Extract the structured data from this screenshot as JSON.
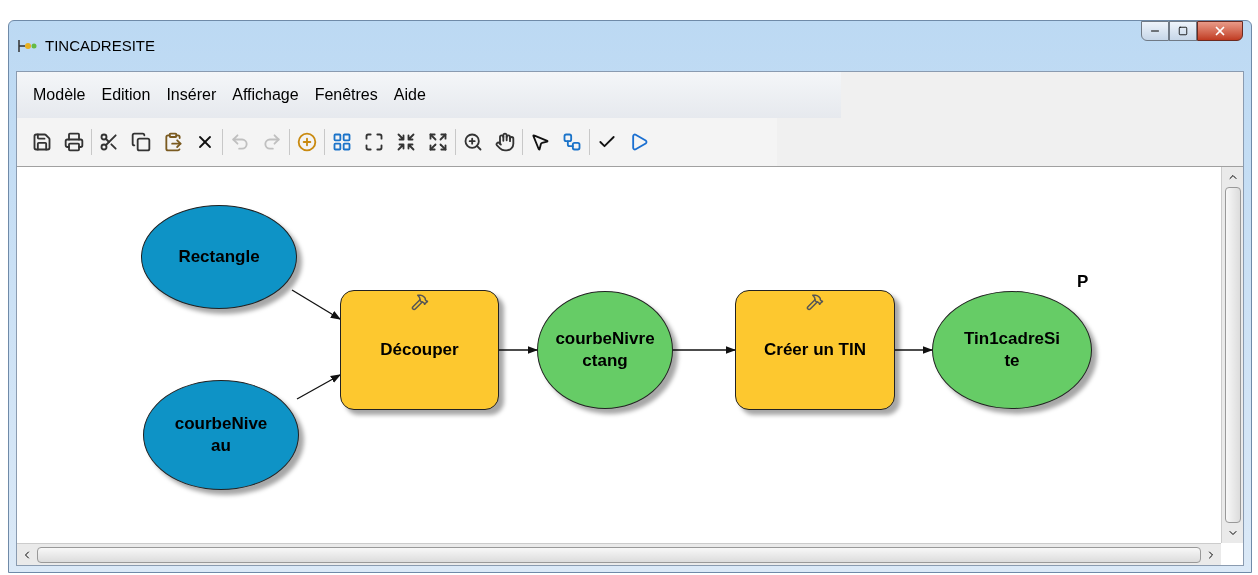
{
  "window": {
    "title": "TINCADRESITE"
  },
  "menu": [
    "Modèle",
    "Edition",
    "Insérer",
    "Affichage",
    "Fenêtres",
    "Aide"
  ],
  "toolbar": [
    [
      {
        "disabled": false
      },
      {
        "disabled": false
      }
    ],
    [
      {
        "disabled": false
      },
      {
        "disabled": false
      },
      {
        "disabled": false
      },
      {
        "disabled": false
      }
    ],
    [
      {
        "disabled": true
      },
      {
        "disabled": true
      }
    ],
    [
      {
        "disabled": false
      }
    ],
    [
      {
        "disabled": false
      },
      {
        "disabled": false
      },
      {
        "disabled": false
      },
      {
        "disabled": false
      }
    ],
    [
      {
        "disabled": false
      },
      {
        "disabled": false
      }
    ],
    [
      {
        "disabled": false
      },
      {
        "disabled": false
      }
    ],
    [
      {
        "disabled": false
      },
      {
        "disabled": false
      }
    ]
  ],
  "diagram": {
    "nodes": [
      {
        "kind": "variable",
        "color": "#0e93c6",
        "lines": [
          "Rectangle"
        ]
      },
      {
        "kind": "variable",
        "color": "#0e93c6",
        "lines": [
          "courbeNive",
          "au"
        ]
      },
      {
        "kind": "tool",
        "color": "#fdc82f",
        "lines": [
          "Découper"
        ]
      },
      {
        "kind": "variable",
        "color": "#66cc66",
        "lines": [
          "courbeNivre",
          "ctang"
        ]
      },
      {
        "kind": "tool",
        "color": "#fdc82f",
        "lines": [
          "Créer un TIN"
        ]
      },
      {
        "kind": "variable",
        "color": "#66cc66",
        "lines": [
          "Tin1cadreSi",
          "te"
        ]
      }
    ],
    "marker": "P"
  }
}
